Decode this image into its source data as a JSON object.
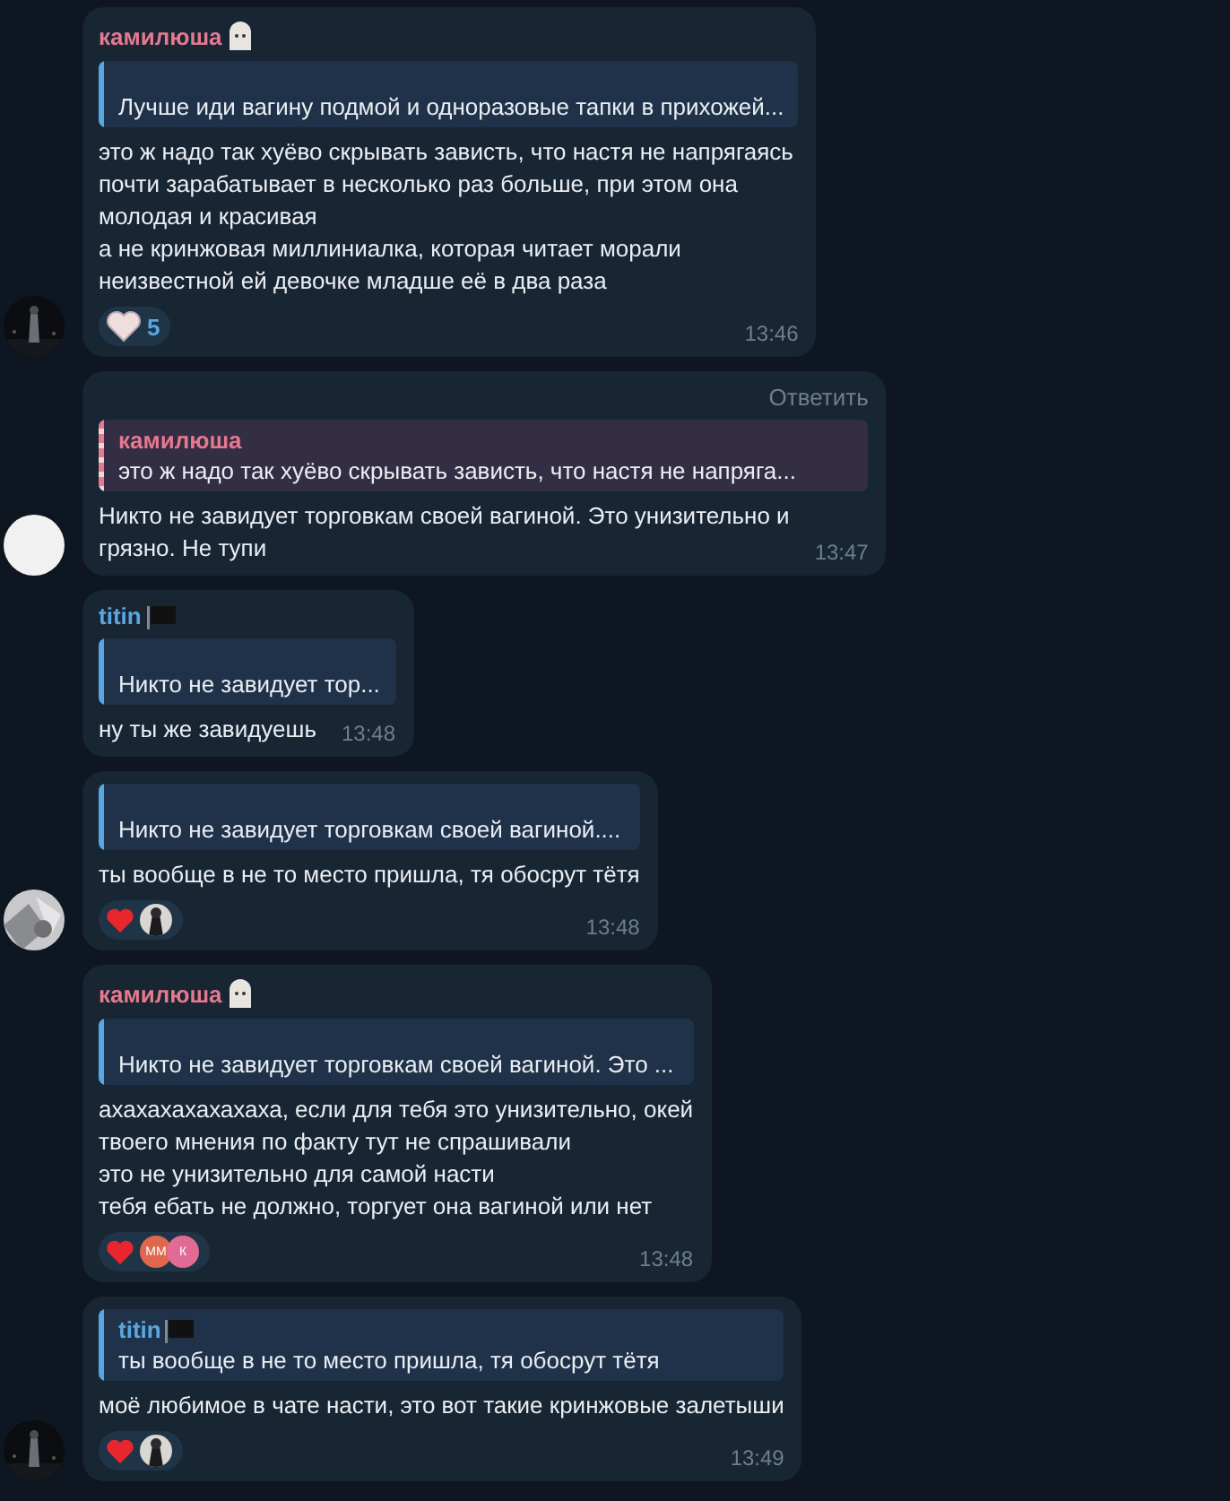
{
  "messages": [
    {
      "sender": {
        "name": "камилюша",
        "color": "#e5798f",
        "badge": {
          "kind": "ghost"
        }
      },
      "reply": {
        "text": "Лучше иди вагину подмой и одноразовые тапки в прихожей...",
        "kind": "plain"
      },
      "text": "это ж надо так хуёво скрывать зависть, что настя не напрягаясь\nпочти зарабатывает в несколько раз больше, при этом она\nмолодая и красивая\nа не кринжовая миллиниалка, которая читает морали\nнеизвестной ей девочке младше её в два раза",
      "reactions": {
        "kind": "sticker",
        "count": "5"
      },
      "time": "13:46",
      "avatar": {
        "kind": "dark"
      }
    },
    {
      "reply_action": "Ответить",
      "reply": {
        "name": "камилюша",
        "text": "это ж надо так хуёво скрывать зависть, что настя не напряга...",
        "kind": "striped"
      },
      "text": "Никто не завидует торговкам своей вагиной. Это унизительно и\nгрязно. Не тупи",
      "time": "13:47",
      "avatar": {
        "kind": "white"
      }
    },
    {
      "sender": {
        "name": "titin",
        "color": "#5aa6e0",
        "badge": {
          "kind": "flag"
        }
      },
      "reply": {
        "text": "Никто не завидует тор...",
        "kind": "plain"
      },
      "text": "ну ты же завидуешь",
      "time": "13:48"
    },
    {
      "reply": {
        "text": "Никто не завидует торговкам своей вагиной....",
        "kind": "plain"
      },
      "text": "ты вообще в не то место пришла, тя обосрут тётя",
      "reactions": {
        "kind": "heart"
      },
      "time": "13:48",
      "avatar": {
        "kind": "grey"
      }
    },
    {
      "sender": {
        "name": "камилюша",
        "color": "#e5798f",
        "badge": {
          "kind": "ghost"
        }
      },
      "reply": {
        "text": "Никто не завидует торговкам своей вагиной. Это ...",
        "kind": "plain"
      },
      "text": "ахахахахахахаха, если для тебя это унизительно, окей\nтвоего мнения по факту тут не спрашивали\nэто не унизительно для самой насти\nтебя ебать не должно, торгует она вагиной или нет",
      "reactions": {
        "kind": "heart",
        "users": [
          {
            "kind": "initials",
            "initials": "ММ",
            "color": "#e0674d"
          },
          {
            "kind": "initials",
            "initials": "К",
            "color": "#e06c96"
          }
        ]
      },
      "time": "13:48"
    },
    {
      "reply": {
        "name": "titin",
        "badge": {
          "kind": "flag"
        },
        "text": "ты вообще в не то место пришла, тя обосрут тётя",
        "kind": "plain"
      },
      "text": "моё любимое в чате насти, это вот такие кринжовые залетыши",
      "reactions": {
        "kind": "heart"
      },
      "time": "13:49",
      "avatar": {
        "kind": "dark"
      }
    }
  ]
}
